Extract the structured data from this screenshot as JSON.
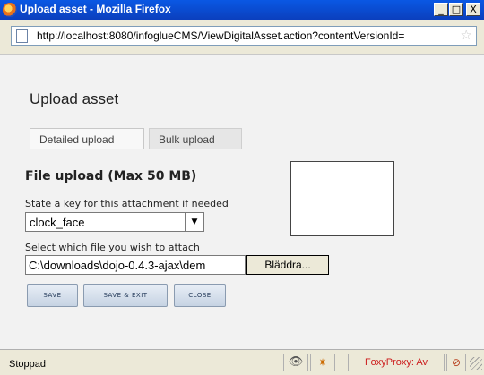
{
  "window": {
    "title": "Upload asset - Mozilla Firefox",
    "minimize": "_",
    "maximize": "□",
    "close": "X"
  },
  "browser": {
    "url": "http://localhost:8080/infoglueCMS/ViewDigitalAsset.action?contentVersionId=",
    "bookmark_icon": "☆"
  },
  "page": {
    "heading": "Upload asset",
    "tabs": [
      {
        "label": "Detailed upload",
        "active": true
      },
      {
        "label": "Bulk upload",
        "active": false
      }
    ],
    "file_upload_title": "File upload (Max 50 MB)",
    "key_label": "State a key for this attachment if needed",
    "key_value": "clock_face",
    "file_label": "Select which file you wish to attach",
    "file_value": "C:\\downloads\\dojo-0.4.3-ajax\\dem",
    "browse_label": "Bläddra...",
    "buttons": {
      "save": "SAVE",
      "save_exit": "SAVE & EXIT",
      "close": "CLOSE"
    }
  },
  "statusbar": {
    "text": "Stoppad",
    "foxyproxy": "FoxyProxy: Av"
  }
}
